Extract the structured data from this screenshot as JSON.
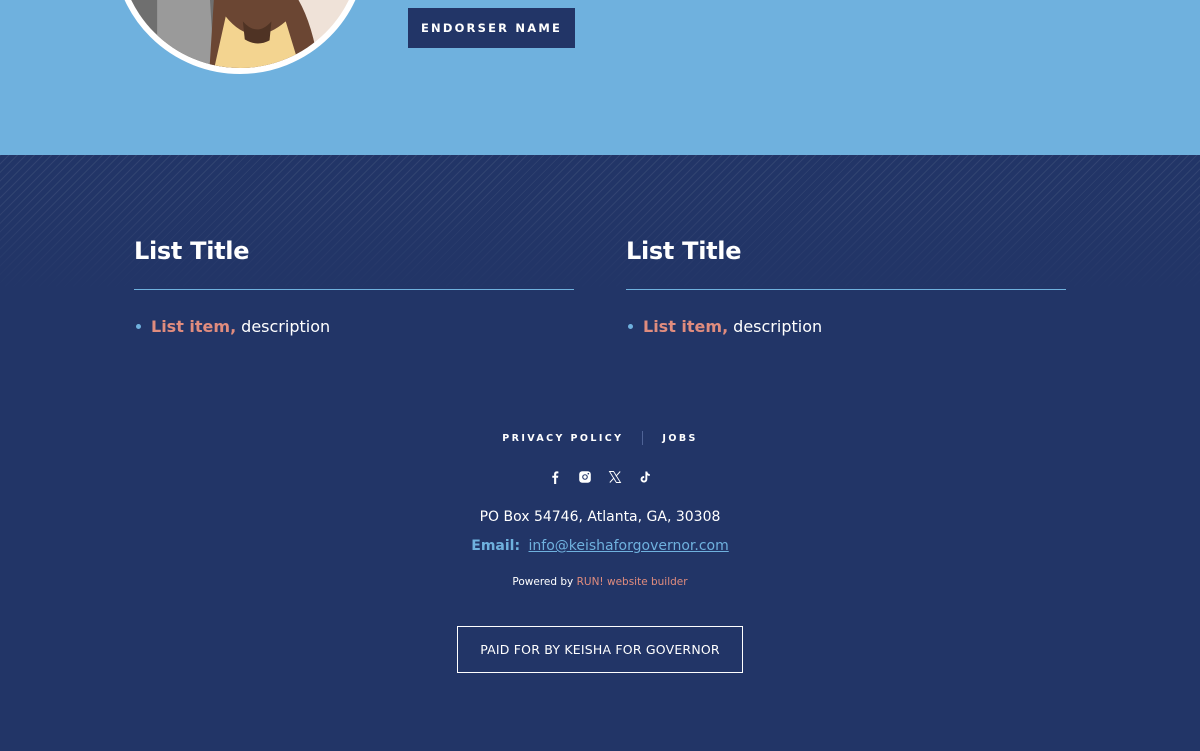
{
  "endorsement": {
    "button_label": "ENDORSER NAME"
  },
  "lists": [
    {
      "title": "List Title",
      "items": [
        {
          "strong": "List item,",
          "description": "description"
        }
      ]
    },
    {
      "title": "List Title",
      "items": [
        {
          "strong": "List item,",
          "description": "description"
        }
      ]
    }
  ],
  "footer": {
    "nav": [
      {
        "label": "PRIVACY POLICY"
      },
      {
        "label": "JOBS"
      }
    ],
    "social_icons": [
      "facebook-icon",
      "instagram-icon",
      "x-icon",
      "tiktok-icon"
    ],
    "address": "PO Box 54746, Atlanta, GA, 30308",
    "email_label": "Email:",
    "email": "info@keishaforgovernor.com",
    "powered_prefix": "Powered by",
    "powered_link": "RUN! website builder",
    "paid_for": "PAID FOR BY KEISHA FOR GOVERNOR"
  },
  "colors": {
    "band_blue": "#6fb1de",
    "navy": "#223567",
    "accent_salmon": "#e08c7e",
    "link_blue": "#6fb1de"
  }
}
